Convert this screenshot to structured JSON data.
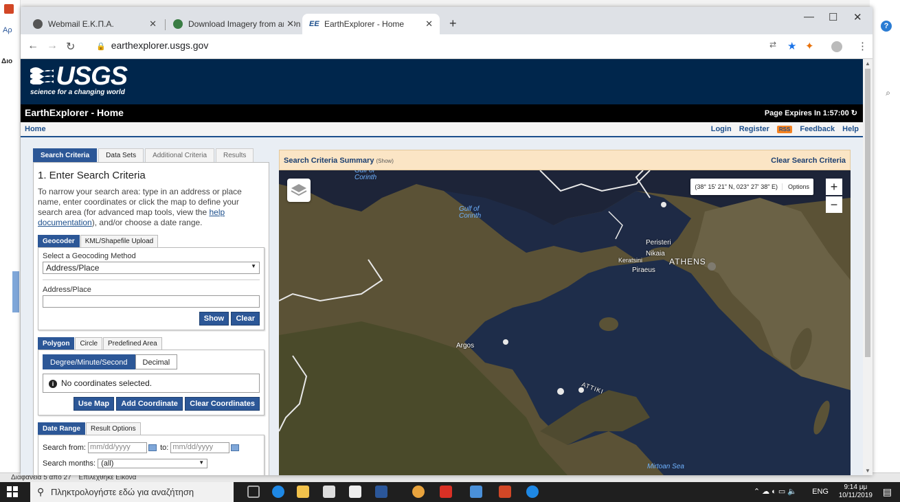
{
  "background_app": {
    "status_slide": "Διαφάνεια 5 από 27",
    "status_selected": "Επιλέχθηκε Εικόνα",
    "left_fragment": "Διο",
    "top_fragment": "Αρ"
  },
  "browser": {
    "tabs": [
      {
        "label": "Webmail E.K.Π.A."
      },
      {
        "label": "Download Imagery from an Onli"
      },
      {
        "label": "EarthExplorer - Home"
      }
    ],
    "url": "earthexplorer.usgs.gov"
  },
  "site": {
    "logo_word": "USGS",
    "logo_tagline": "science for a changing world",
    "title": "EarthExplorer - Home",
    "expires": "Page Expires In 1:57:00",
    "breadcrumb": "Home",
    "nav": {
      "login": "Login",
      "register": "Register",
      "rss": "RSS",
      "feedback": "Feedback",
      "help": "Help"
    }
  },
  "left_panel": {
    "tabs": [
      "Search Criteria",
      "Data Sets",
      "Additional Criteria",
      "Results"
    ],
    "heading": "1. Enter Search Criteria",
    "intro_before": "To narrow your search area: type in an address or place name, enter coordinates or click the map to define your search area (for advanced map tools, view the ",
    "intro_link": "help documentation",
    "intro_after": "), and/or choose a date range.",
    "geocoder_tabs": [
      "Geocoder",
      "KML/Shapefile Upload"
    ],
    "geocoding_label": "Select a Geocoding Method",
    "geocoding_value": "Address/Place",
    "address_label": "Address/Place",
    "show_button": "Show",
    "clear_button": "Clear",
    "area_tabs": [
      "Polygon",
      "Circle",
      "Predefined Area"
    ],
    "format_options": [
      "Degree/Minute/Second",
      "Decimal"
    ],
    "no_coords": "No coordinates selected.",
    "use_map": "Use Map",
    "add_coordinate": "Add Coordinate",
    "clear_coordinates": "Clear Coordinates",
    "date_tabs": [
      "Date Range",
      "Result Options"
    ],
    "search_from_label": "Search from:",
    "date_placeholder": "mm/dd/yyyy",
    "to_label": "to:",
    "search_months_label": "Search months:",
    "search_months_value": "(all)"
  },
  "map": {
    "summary_title": "Search Criteria Summary",
    "summary_show": "(Show)",
    "clear_criteria": "Clear Search Criteria",
    "coordinates": "(38° 15' 21\" N, 023° 27' 38\" E)",
    "options": "Options",
    "zoom_in": "+",
    "zoom_out": "−",
    "labels": {
      "gulf_top": "Gulf of Corinth",
      "gulf": "Gulf of Corinth",
      "peristeri": "Peristeri",
      "nikaia": "Nikaia",
      "keratsini": "Keratsini",
      "athens": "ATHENS",
      "piraeus": "Piraeus",
      "argos": "Argos",
      "attiki": "ATTIKI",
      "myrtoan": "Mirtoan Sea"
    }
  },
  "taskbar": {
    "search_placeholder": "Πληκτρολογήστε εδώ για αναζήτηση",
    "lang": "ENG",
    "time": "9:14 μμ",
    "date": "10/11/2019"
  }
}
